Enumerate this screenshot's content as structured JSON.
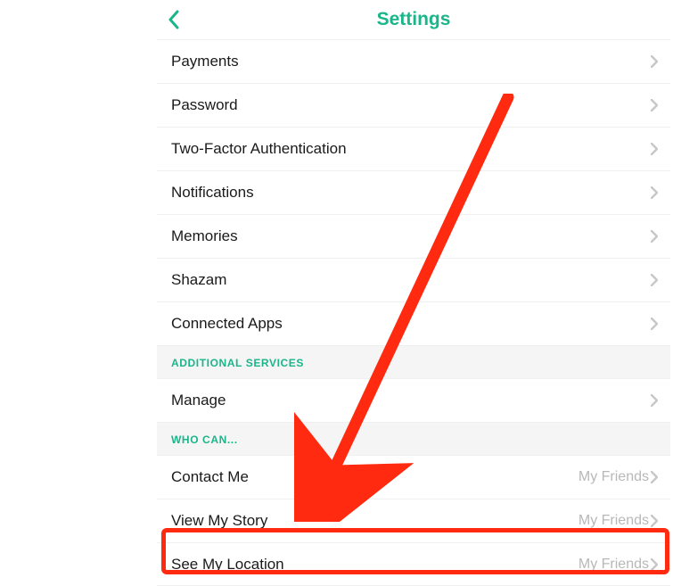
{
  "header": {
    "title": "Settings"
  },
  "rows": [
    {
      "type": "item",
      "label": "Payments",
      "value": ""
    },
    {
      "type": "item",
      "label": "Password",
      "value": ""
    },
    {
      "type": "item",
      "label": "Two-Factor Authentication",
      "value": ""
    },
    {
      "type": "item",
      "label": "Notifications",
      "value": ""
    },
    {
      "type": "item",
      "label": "Memories",
      "value": ""
    },
    {
      "type": "item",
      "label": "Shazam",
      "value": ""
    },
    {
      "type": "item",
      "label": "Connected Apps",
      "value": ""
    },
    {
      "type": "section",
      "label": "ADDITIONAL SERVICES"
    },
    {
      "type": "item",
      "label": "Manage",
      "value": ""
    },
    {
      "type": "section",
      "label": "WHO CAN..."
    },
    {
      "type": "item",
      "label": "Contact Me",
      "value": "My Friends"
    },
    {
      "type": "item",
      "label": "View My Story",
      "value": "My Friends"
    },
    {
      "type": "item",
      "label": "See My Location",
      "value": "My Friends"
    }
  ]
}
